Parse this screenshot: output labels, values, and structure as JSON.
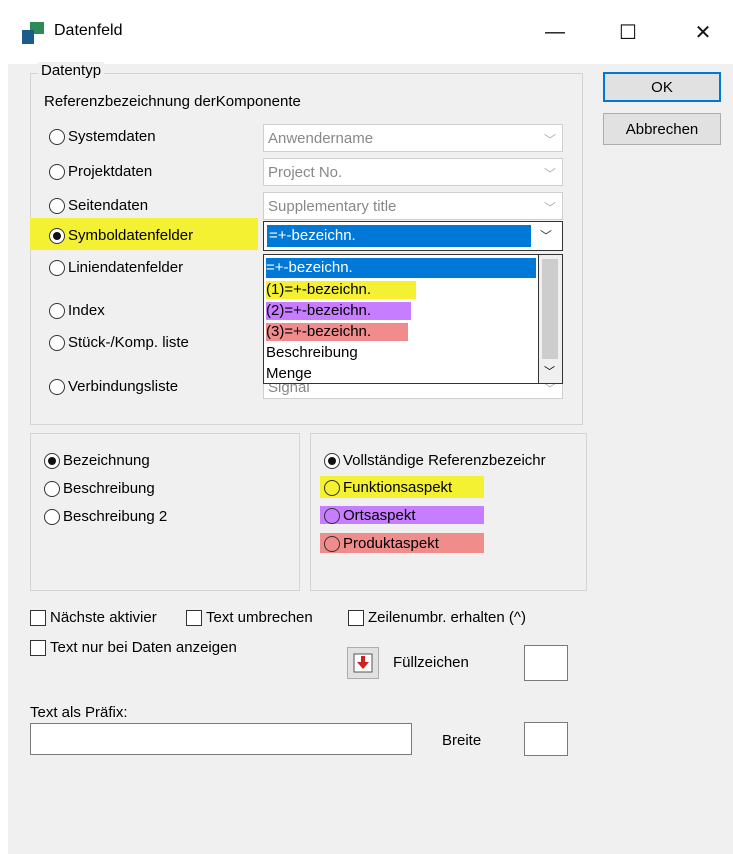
{
  "window": {
    "title": "Datenfeld",
    "minimize": "—",
    "maximize": "☐",
    "close": "✕"
  },
  "datatype": {
    "group_label": "Datentyp",
    "sub_label": "Referenzbezeichnung derKomponente",
    "options": [
      {
        "label": "Systemdaten",
        "value": "Anwendername",
        "selected": false
      },
      {
        "label": "Projektdaten",
        "value": "Project No.",
        "selected": false
      },
      {
        "label": "Seitendaten",
        "value": "Supplementary title",
        "selected": false
      },
      {
        "label": "Symboldatenfelder",
        "value": "=+-bezeichn.",
        "selected": true
      },
      {
        "label": "Liniendatenfelder",
        "selected": false
      },
      {
        "label": "Index",
        "selected": false
      },
      {
        "label": "Stück-/Komp. liste",
        "selected": false
      },
      {
        "label": "Verbindungsliste",
        "value": "Signal",
        "selected": false
      }
    ],
    "dropdown_items": [
      "=+-bezeichn.",
      "(1)=+-bezeichn.",
      "(2)=+-bezeichn.",
      "(3)=+-bezeichn.",
      "Beschreibung",
      "Menge"
    ]
  },
  "display": {
    "options": [
      "Bezeichnung",
      "Beschreibung",
      "Beschreibung 2"
    ],
    "selected": "Bezeichnung"
  },
  "reference": {
    "options": [
      "Vollständige Referenzbezeichr",
      "Funktionsaspekt",
      "Ortsaspekt",
      "Produktaspekt"
    ],
    "selected": "Vollständige Referenzbezeichr"
  },
  "checks": {
    "next": "Nächste aktivier",
    "wrap": "Text umbrechen",
    "keep": "Zeilenumbr. erhalten (^)",
    "only_data": "Text nur bei Daten anzeigen"
  },
  "fill": {
    "label": "Füllzeichen",
    "value": ""
  },
  "prefix": {
    "label": "Text als Präfix:",
    "value": ""
  },
  "width": {
    "label": "Breite",
    "value": ""
  },
  "buttons": {
    "ok": "OK",
    "cancel": "Abbrechen"
  },
  "colors": {
    "yellow": "#f4f032",
    "purple": "#c77dff",
    "pink": "#f08c8c",
    "selection": "#0078d7"
  }
}
